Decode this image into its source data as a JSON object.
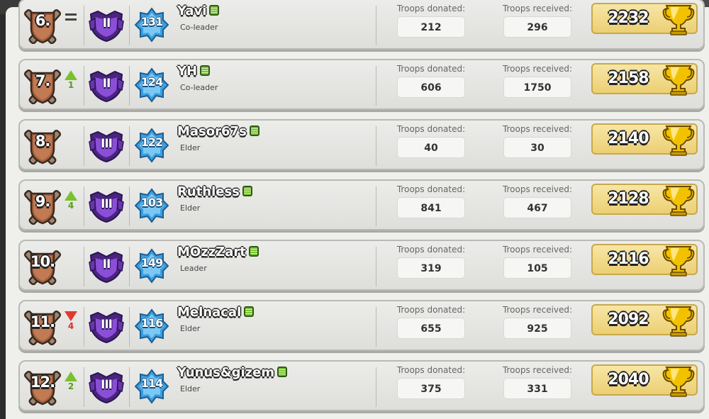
{
  "header": {
    "tabs": [
      "",
      "",
      ""
    ]
  },
  "stat_labels": {
    "donated": "Troops donated:",
    "received": "Troops received:"
  },
  "icons": {
    "rank_badge": "crossed-swords-shield-icon",
    "league": "purple-league-badge-icon",
    "level": "blue-star-level-icon",
    "online": "online-status-icon",
    "trophy": "gold-trophy-icon",
    "up": "green-up-arrow-icon",
    "down": "red-down-arrow-icon",
    "same": "equals-icon"
  },
  "colors": {
    "up": "#79c12e",
    "down": "#e23a2f",
    "league": "#7a3fc2",
    "level": "#3a9fe0",
    "trophy_bg": "#eccf73"
  },
  "members": [
    {
      "rank": "6.",
      "change": "same",
      "change_value": "",
      "league": "II",
      "level": "131",
      "name": "Yavi",
      "role": "Co-leader",
      "donated": "212",
      "received": "296",
      "trophies": "2232"
    },
    {
      "rank": "7.",
      "change": "up",
      "change_value": "1",
      "league": "II",
      "level": "124",
      "name": "YH",
      "role": "Co-leader",
      "donated": "606",
      "received": "1750",
      "trophies": "2158"
    },
    {
      "rank": "8.",
      "change": "none",
      "change_value": "",
      "league": "III",
      "level": "122",
      "name": "Masor67s",
      "role": "Elder",
      "donated": "40",
      "received": "30",
      "trophies": "2140"
    },
    {
      "rank": "9.",
      "change": "up",
      "change_value": "4",
      "league": "III",
      "level": "103",
      "name": "Ruthless",
      "role": "Elder",
      "donated": "841",
      "received": "467",
      "trophies": "2128"
    },
    {
      "rank": "10.",
      "change": "none",
      "change_value": "",
      "league": "II",
      "level": "149",
      "name": "MOzzZart",
      "role": "Leader",
      "donated": "319",
      "received": "105",
      "trophies": "2116"
    },
    {
      "rank": "11.",
      "change": "down",
      "change_value": "4",
      "league": "III",
      "level": "116",
      "name": "Melnacal",
      "role": "Elder",
      "donated": "655",
      "received": "925",
      "trophies": "2092"
    },
    {
      "rank": "12.",
      "change": "up",
      "change_value": "2",
      "league": "III",
      "level": "114",
      "name": "Yunus&gizem",
      "role": "Elder",
      "donated": "375",
      "received": "331",
      "trophies": "2040"
    }
  ]
}
